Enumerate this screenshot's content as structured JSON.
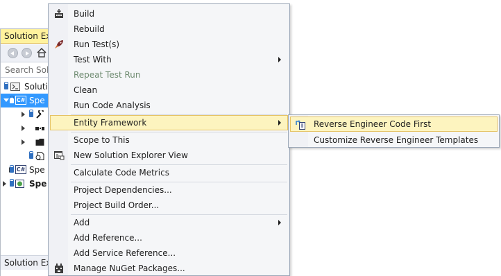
{
  "solution_explorer": {
    "title": "Solution Exp",
    "search_placeholder": "Search Solu",
    "footer": "Solution Exp",
    "rows": [
      {
        "label": "Solution"
      },
      {
        "label": "Spe"
      },
      {
        "label": ""
      },
      {
        "label": ""
      },
      {
        "label": ""
      },
      {
        "label": ""
      },
      {
        "label": "Spe"
      },
      {
        "label": "Spe"
      }
    ]
  },
  "context_menu": {
    "items": [
      {
        "label": "Build",
        "icon": "build-icon"
      },
      {
        "label": "Rebuild"
      },
      {
        "label": "Run Test(s)",
        "icon": "rocket-icon"
      },
      {
        "label": "Test With",
        "submenu": true
      },
      {
        "label": "Repeat Test Run",
        "disabled": true
      },
      {
        "label": "Clean"
      },
      {
        "label": "Run Code Analysis"
      },
      {
        "label": "Entity Framework",
        "submenu": true,
        "highlighted": true
      },
      {
        "label": "Scope to This"
      },
      {
        "label": "New Solution Explorer View",
        "icon": "new-view-icon"
      },
      {
        "label": "Calculate Code Metrics"
      },
      {
        "label": "Project Dependencies..."
      },
      {
        "label": "Project Build Order..."
      },
      {
        "label": "Add",
        "submenu": true
      },
      {
        "label": "Add Reference..."
      },
      {
        "label": "Add Service Reference..."
      },
      {
        "label": "Manage NuGet Packages...",
        "icon": "nuget-icon"
      }
    ]
  },
  "entity_framework_submenu": {
    "items": [
      {
        "label": "Reverse Engineer Code First",
        "icon": "reverse-engineer-icon",
        "highlighted": true
      },
      {
        "label": "Customize Reverse Engineer Templates"
      }
    ]
  },
  "colors": {
    "highlight_fill": "#fdf4bf",
    "highlight_border": "#e5c365",
    "selection_blue": "#3399ff",
    "disabled_text": "#6d8a6f"
  }
}
